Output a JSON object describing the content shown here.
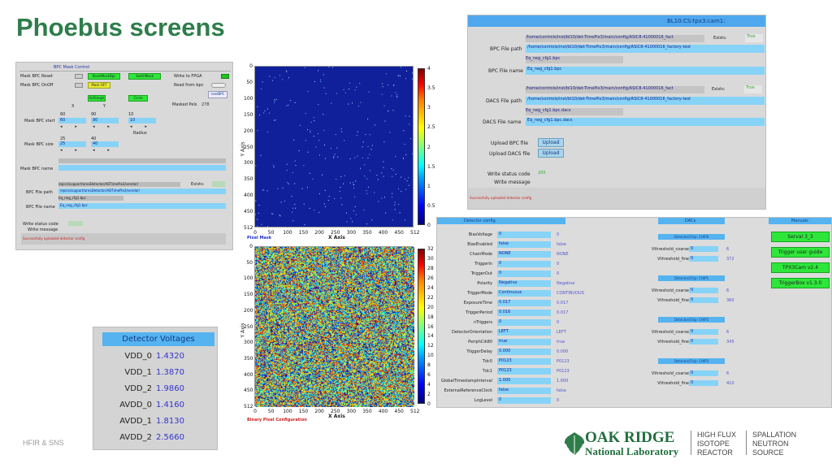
{
  "title": "Phoebus screens",
  "footer_left": "HFIR & SNS",
  "logo": {
    "line1": "OAK RIDGE",
    "line2": "National Laboratory",
    "col2": [
      "HIGH FLUX",
      "ISOTOPE",
      "REACTOR"
    ],
    "col3": [
      "SPALLATION",
      "NEUTRON",
      "SOURCE"
    ]
  },
  "bpc_mask": {
    "header": "BPC Mask Control",
    "mask_bpc_reset": "Mask BPC Reset",
    "mask_bpc_onoff": "Mask BPC OnOff",
    "reset_btn": "ResetMaskBpc",
    "setall_btn": "SetAllMask",
    "mask_off_btn": "Mask OFF",
    "write_fpga": "Write to FPGA",
    "read_bpc": "Read from bpc",
    "read_bpc_btn": "readBPC",
    "masked_pels": "Masked Pels",
    "masked_pels_val": "278",
    "set_single": "SetSingle",
    "circle": "Circle",
    "x_lbl": "X",
    "y_lbl": "Y",
    "mask_bpc_start": "Mask BPC start",
    "start_x": "60",
    "start_x_input": "60",
    "start_y": "90",
    "start_y_input": "90",
    "radius_val": "10",
    "radius_input": "10",
    "radius": "Radius",
    "mask_bpc_size": "Mask BPC size",
    "size_x": "25",
    "size_x_input": "25",
    "size_y": "40",
    "size_y_input": "40",
    "mask_bpc_name": "Mask BPC name",
    "bpc_file_path": "BPC File path",
    "path_top": "/epics/support/areaDetector/ADTimePix3/vendor/",
    "exists": "Exists:",
    "path_input": "/epics/support/areaDetector/ADTimePix3/vendor/",
    "path_sub": "Eq_neg_cfg1.bpc",
    "bpc_file_name": "BPC File name",
    "file_name_val": "Eq_neg_cfg1.bpc",
    "write_status_code": "Write status code",
    "write_message": "Write message",
    "status_msg": "Successfully uploaded detector config"
  },
  "plots": {
    "pixel_mask": "Pixel Mask",
    "binary_pixel": "Binary Pixel Configuration",
    "xaxis": "X Axis",
    "yaxis": "Y Axis",
    "ticks": [
      "0",
      "50",
      "100",
      "150",
      "200",
      "250",
      "300",
      "350",
      "400",
      "450",
      "512"
    ],
    "cbar1": [
      "4",
      "3.5",
      "3",
      "2.5",
      "2",
      "1.5",
      "1",
      "0.5",
      "0"
    ],
    "cbar2": [
      "32",
      "30",
      "28",
      "26",
      "24",
      "22",
      "20",
      "18",
      "16",
      "14",
      "12",
      "10",
      "8",
      "6",
      "4",
      "2",
      "0"
    ]
  },
  "voltages": {
    "header": "Detector Voltages",
    "rows": [
      {
        "label": "VDD_0",
        "value": "1.4320"
      },
      {
        "label": "VDD_1",
        "value": "1.3870"
      },
      {
        "label": "VDD_2",
        "value": "1.9860"
      },
      {
        "label": "AVDD_0",
        "value": "1.4160"
      },
      {
        "label": "AVDD_1",
        "value": "1.8130"
      },
      {
        "label": "AVDD_2",
        "value": "2.5660"
      }
    ]
  },
  "cam": {
    "header": "BL10:CS:tpx3:cam1:",
    "bpc_path_top": "/home/controls/inst/bl10/det-TimePix3/main/config/ASIC8-41000016_fact",
    "exists": "Exists:",
    "bpc_exists_val": "True",
    "bpc_file_path": "BPC File path",
    "bpc_path_input": "/home/controls/inst/bl10/det-TimePix3/main/config/ASIC8-41000016_factory-test",
    "bpc_name_top": "Eq_neg_cfg1.bpc",
    "bpc_file_name": "BPC File name",
    "bpc_name_input": "Eq_neg_cfg1.bpc",
    "dacs_path_top": "/home/controls/inst/bl10/det-TimePix3/main/config/ASIC8-41000016_fact",
    "dacs_exists_val": "True",
    "dacs_file_path": "DACS File path",
    "dacs_path_input": "/home/controls/inst/bl10/det-TimePix3/main/config/ASIC8-41000016_factory-test",
    "dacs_name_top": "Eq_neg_cfg1.bpc.dacs",
    "dacs_file_name": "DACS File name",
    "dacs_name_input": "Eq_neg_cfg1.bpc.dacs",
    "upload_bpc": "Upload BPC file",
    "upload_dacs": "Upload DACS file",
    "upload": "Upload",
    "write_status_code": "Write status code",
    "status_code_val": "200",
    "write_message": "Write message",
    "status_msg": "Successfully uploaded detector config"
  },
  "detcfg": {
    "header": "Detector config",
    "rows": [
      {
        "label": "BiasVoltage",
        "input": "0",
        "value": "0"
      },
      {
        "label": "BiasEnabled",
        "input": "false",
        "value": "false"
      },
      {
        "label": "ChainMode",
        "input": "NONE",
        "value": "NONE"
      },
      {
        "label": "TriggerIn",
        "input": "0",
        "value": "0"
      },
      {
        "label": "TriggerOut",
        "input": "0",
        "value": "0"
      },
      {
        "label": "Polarity",
        "input": "Negative",
        "value": "Negative"
      },
      {
        "label": "TriggerMode",
        "input": "Continuous",
        "value": "CONTINUOUS"
      },
      {
        "label": "ExposureTime",
        "input": "0.017",
        "value": "0.017"
      },
      {
        "label": "TriggerPeriod",
        "input": "0.016",
        "value": "0.017"
      },
      {
        "label": "nTriggers",
        "input": "0",
        "value": "0"
      },
      {
        "label": "DetectorOrientation",
        "input": "LEFT",
        "value": "LEFT"
      },
      {
        "label": "PeriphClk80",
        "input": "true",
        "value": "true"
      },
      {
        "label": "TriggerDelay",
        "input": "0.000",
        "value": "0.000"
      },
      {
        "label": "Tdc0",
        "input": "P0123",
        "value": "P0123"
      },
      {
        "label": "Tdc1",
        "input": "P0123",
        "value": "P0123"
      },
      {
        "label": "GlobalTimestampInterval",
        "input": "1.000",
        "value": "1.000"
      },
      {
        "label": "ExternalReferenceClock",
        "input": "false",
        "value": "false"
      },
      {
        "label": "LogLevel",
        "input": "0",
        "value": "0"
      }
    ]
  },
  "dacs": {
    "header": "DACs",
    "chips": [
      {
        "title": "Detector/Chip: CHIP0",
        "coarse_label": "Vthreshold_coarse",
        "coarse_in": "0",
        "coarse_val": "6",
        "fine_label": "Vthreshold_fine",
        "fine_in": "0",
        "fine_val": "372"
      },
      {
        "title": "Detector/Chip: CHIP1",
        "coarse_label": "Vthreshold_coarse",
        "coarse_in": "0",
        "coarse_val": "6",
        "fine_label": "Vthreshold_fine",
        "fine_in": "0",
        "fine_val": "360"
      },
      {
        "title": "Detector/Chip: CHIP2",
        "coarse_label": "Vthreshold_coarse",
        "coarse_in": "0",
        "coarse_val": "6",
        "fine_label": "Vthreshold_fine",
        "fine_in": "0",
        "fine_val": "345"
      },
      {
        "title": "Detector/Chip: CHIP3",
        "coarse_label": "Vthreshold_coarse",
        "coarse_in": "0",
        "coarse_val": "6",
        "fine_label": "Vthreshold_fine",
        "fine_in": "0",
        "fine_val": "410"
      }
    ]
  },
  "manuals": {
    "header": "Manuals",
    "buttons": [
      "Serval 3_3",
      "Trigger user guide",
      "TPX3Cam v2.4",
      "TriggerBox v1.3.0"
    ]
  }
}
